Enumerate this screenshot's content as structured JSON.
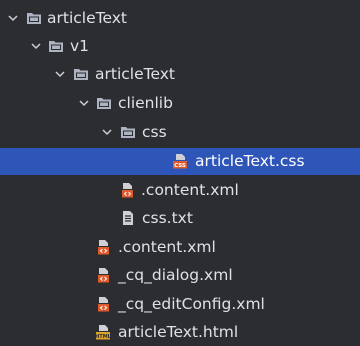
{
  "tree": {
    "items": [
      {
        "label": "articleText",
        "icon": "folder-icon",
        "expanded": true
      },
      {
        "label": "v1",
        "icon": "folder-icon",
        "expanded": true
      },
      {
        "label": "articleText",
        "icon": "folder-icon",
        "expanded": true
      },
      {
        "label": "clienlib",
        "icon": "folder-icon",
        "expanded": true
      },
      {
        "label": "css",
        "icon": "folder-icon",
        "expanded": true
      },
      {
        "label": "articleText.css",
        "icon": "css-file-icon",
        "selected": true
      },
      {
        "label": ".content.xml",
        "icon": "xml-file-icon"
      },
      {
        "label": "css.txt",
        "icon": "text-file-icon"
      },
      {
        "label": ".content.xml",
        "icon": "xml-file-icon"
      },
      {
        "label": "_cq_dialog.xml",
        "icon": "xml-file-icon"
      },
      {
        "label": "_cq_editConfig.xml",
        "icon": "xml-file-icon"
      },
      {
        "label": "articleText.html",
        "icon": "html-file-icon"
      }
    ]
  },
  "colors": {
    "background": "#2b2d30",
    "selection": "#2e55b8",
    "text": "#dfe1e5",
    "folder": "#aeb3c2",
    "file_badge_orange": "#e05a2b"
  }
}
